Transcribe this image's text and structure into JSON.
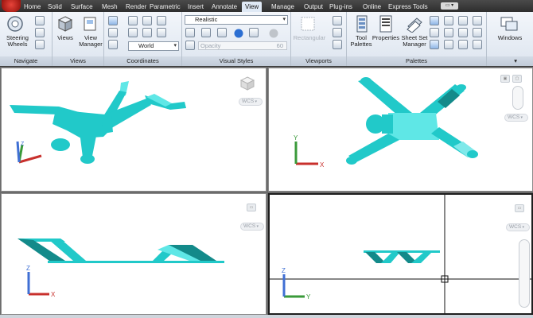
{
  "tabs": [
    "Home",
    "Solid",
    "Surface",
    "Mesh",
    "Render",
    "Parametric",
    "Insert",
    "Annotate",
    "View",
    "Manage",
    "Output",
    "Plug-ins",
    "Online",
    "Express Tools"
  ],
  "active_tab": "View",
  "panels": {
    "navigate": {
      "title": "Navigate",
      "steering_label": "Steering\nWheels"
    },
    "views": {
      "title": "Views",
      "views_label": "Views",
      "manager_label": "View\nManager"
    },
    "coordinates": {
      "title": "Coordinates",
      "ucs_value": "World"
    },
    "visual_styles": {
      "title": "Visual Styles",
      "style_value": "Realistic",
      "opacity_label": "Opacity",
      "opacity_value": "60"
    },
    "viewports": {
      "title": "Viewports",
      "rectangular_label": "Rectangular"
    },
    "palettes": {
      "title": "Palettes",
      "tool_palettes_label": "Tool\nPalettes",
      "properties_label": "Properties",
      "sheet_set_label": "Sheet Set\nManager"
    },
    "windows": {
      "label": "Windows"
    }
  },
  "viewports": [
    {
      "name": "Top-left",
      "ucs_label": "WCS"
    },
    {
      "name": "Top-right",
      "ucs_label": "WCS"
    },
    {
      "name": "Bottom-left",
      "ucs_label": "WCS"
    },
    {
      "name": "Bottom-right",
      "ucs_label": "WCS",
      "active": true
    }
  ],
  "axis_labels": {
    "x": "X",
    "y": "Y",
    "z": "Z"
  },
  "colors": {
    "model": "#22c9c9",
    "model_dark": "#138a8a",
    "model_light": "#7fe9ea",
    "x_axis": "#d63a2f",
    "y_axis": "#3aa23a",
    "z_axis": "#3e6fd6"
  }
}
